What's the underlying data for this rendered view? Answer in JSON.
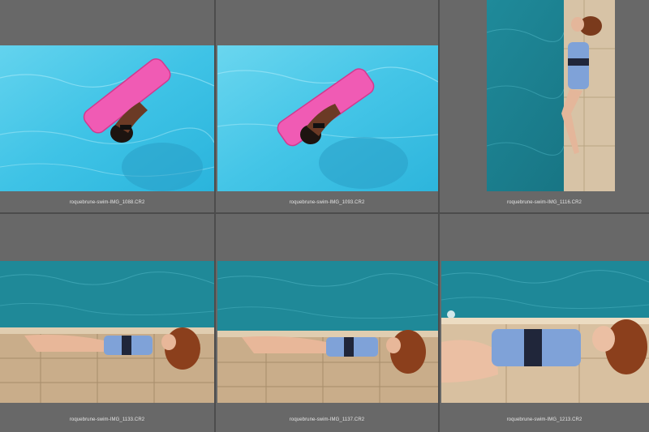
{
  "grid": {
    "thumbnails": [
      {
        "filename": "roquebrune-swim-IMG_1088.CR2",
        "subject": "woman-on-pink-float-in-pool"
      },
      {
        "filename": "roquebrune-swim-IMG_1093.CR2",
        "subject": "woman-on-pink-float-in-pool"
      },
      {
        "filename": "roquebrune-swim-IMG_1116.CR2",
        "subject": "woman-lying-on-pool-edge-vertical"
      },
      {
        "filename": "roquebrune-swim-IMG_1133.CR2",
        "subject": "woman-lying-on-pool-deck"
      },
      {
        "filename": "roquebrune-swim-IMG_1137.CR2",
        "subject": "woman-lying-on-pool-deck"
      },
      {
        "filename": "roquebrune-swim-IMG_1213.CR2",
        "subject": "woman-lying-on-pool-deck-closeup"
      }
    ]
  }
}
